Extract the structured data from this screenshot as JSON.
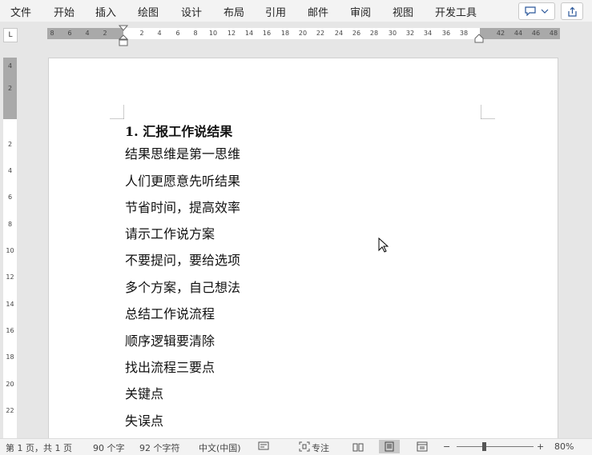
{
  "menu": {
    "items": [
      "文件",
      "开始",
      "插入",
      "绘图",
      "设计",
      "布局",
      "引用",
      "邮件",
      "审阅",
      "视图",
      "开发工具"
    ]
  },
  "top_buttons": {
    "comments_icon": "comment-icon",
    "dropdown_icon": "chevron-down-icon",
    "share_icon": "share-icon"
  },
  "ruler": {
    "corner_label": "L",
    "h_left_labels": [
      "8",
      "6",
      "4",
      "2"
    ],
    "h_right_labels": [
      "2",
      "4",
      "6",
      "8",
      "10",
      "12",
      "14",
      "16",
      "18",
      "20",
      "22",
      "24",
      "26",
      "28",
      "30",
      "32",
      "34",
      "36",
      "38"
    ],
    "h_margin_labels": [
      "42",
      "44",
      "46",
      "48"
    ],
    "v_margin_labels": [
      "4",
      "2"
    ],
    "v_labels": [
      "2",
      "4",
      "6",
      "8",
      "10",
      "12",
      "14",
      "16",
      "18",
      "20",
      "22"
    ]
  },
  "document": {
    "title": "1.  汇报工作说结果",
    "lines": [
      "结果思维是第一思维",
      "人们更愿意先听结果",
      "节省时间，提高效率",
      "请示工作说方案",
      "不要提问，要给选项",
      "多个方案，自己想法",
      "总结工作说流程",
      "顺序逻辑要清除",
      "找出流程三要点",
      "关键点",
      "失误点"
    ]
  },
  "status": {
    "page": "第 1 页，共 1 页",
    "words": "90 个字",
    "chars": "92 个字符",
    "language": "中文(中国)",
    "focus": "专注",
    "zoom_minus": "−",
    "zoom_plus": "+",
    "zoom": "80%"
  },
  "colors": {
    "accent": "#2b579a",
    "ruler_margin": "#a9a9a9"
  }
}
